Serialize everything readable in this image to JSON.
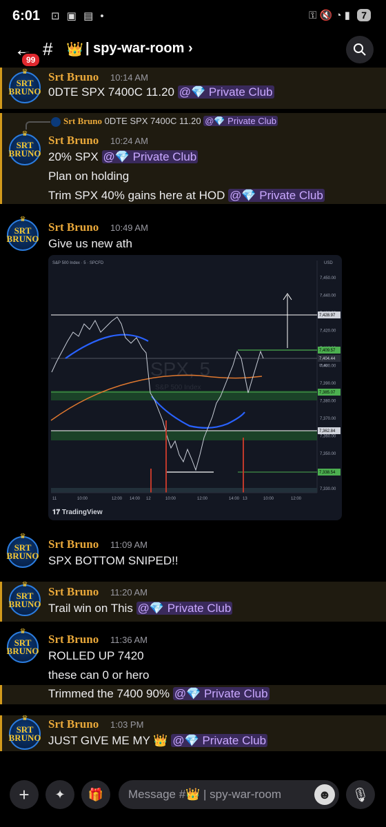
{
  "status": {
    "time": "6:01",
    "battery": "7"
  },
  "header": {
    "unread_badge": "99",
    "hash": "#",
    "channel_icon": "👑",
    "channel_name": "| spy-war-room",
    "chevron": "›"
  },
  "mention_label": "@💎 Private Club",
  "messages": [
    {
      "author": "Srt Bruno",
      "time": "10:14 AM",
      "lines": [
        "0DTE SPX 7400C 11.20"
      ]
    },
    {
      "reply_to": {
        "author": "Srt Bruno",
        "text": "0DTE SPX 7400C 11.20"
      },
      "author": "Srt Bruno",
      "time": "10:24 AM",
      "lines": [
        "20% SPX",
        "Plan on holding",
        "Trim SPX 40% gains here at HOD"
      ]
    },
    {
      "author": "Srt Bruno",
      "time": "10:49 AM",
      "lines": [
        "Give us new ath"
      ]
    },
    {
      "author": "Srt Bruno",
      "time": "11:09 AM",
      "lines": [
        "SPX BOTTOM SNIPED!!"
      ]
    },
    {
      "author": "Srt Bruno",
      "time": "11:20 AM",
      "lines": [
        "Trail win on This"
      ]
    },
    {
      "author": "Srt Bruno",
      "time": "11:36 AM",
      "lines": [
        "ROLLED UP 7420",
        "these can 0 or hero",
        "Trimmed the 7400 90%"
      ]
    },
    {
      "author": "Srt Bruno",
      "time": "1:03 PM",
      "lines": [
        "JUST GIVE ME MY 👑"
      ]
    }
  ],
  "avatar": {
    "line1": "SRT",
    "line2": "BRUNO"
  },
  "chart": {
    "header_text": "S&P 500 Index · 5 · SPCFD",
    "watermark": "SPX, 5",
    "watermark_sub": "S&P 500 Index",
    "currency": "USD",
    "y_ticks": [
      "7,450.00",
      "7,440.00",
      "7,430.00",
      "7,420.00",
      "7,410.00",
      "7,400.00",
      "7,390.00",
      "7,380.00",
      "7,370.00",
      "7,360.00",
      "7,350.00",
      "7,340.00",
      "7,330.00"
    ],
    "price_tags": [
      "7,428.97",
      "7,409.57",
      "7,404.44",
      "7,385.07",
      "7,362.84",
      "7,338.54"
    ],
    "price_tag_small": "01:42",
    "x_ticks": [
      "11",
      "10:00",
      "12:00",
      "14:00",
      "12",
      "10:00",
      "12:00",
      "14:00",
      "13",
      "10:00",
      "12:00"
    ],
    "logo": "TradingView"
  },
  "composer": {
    "placeholder": "Message #👑 | spy-war-room"
  }
}
